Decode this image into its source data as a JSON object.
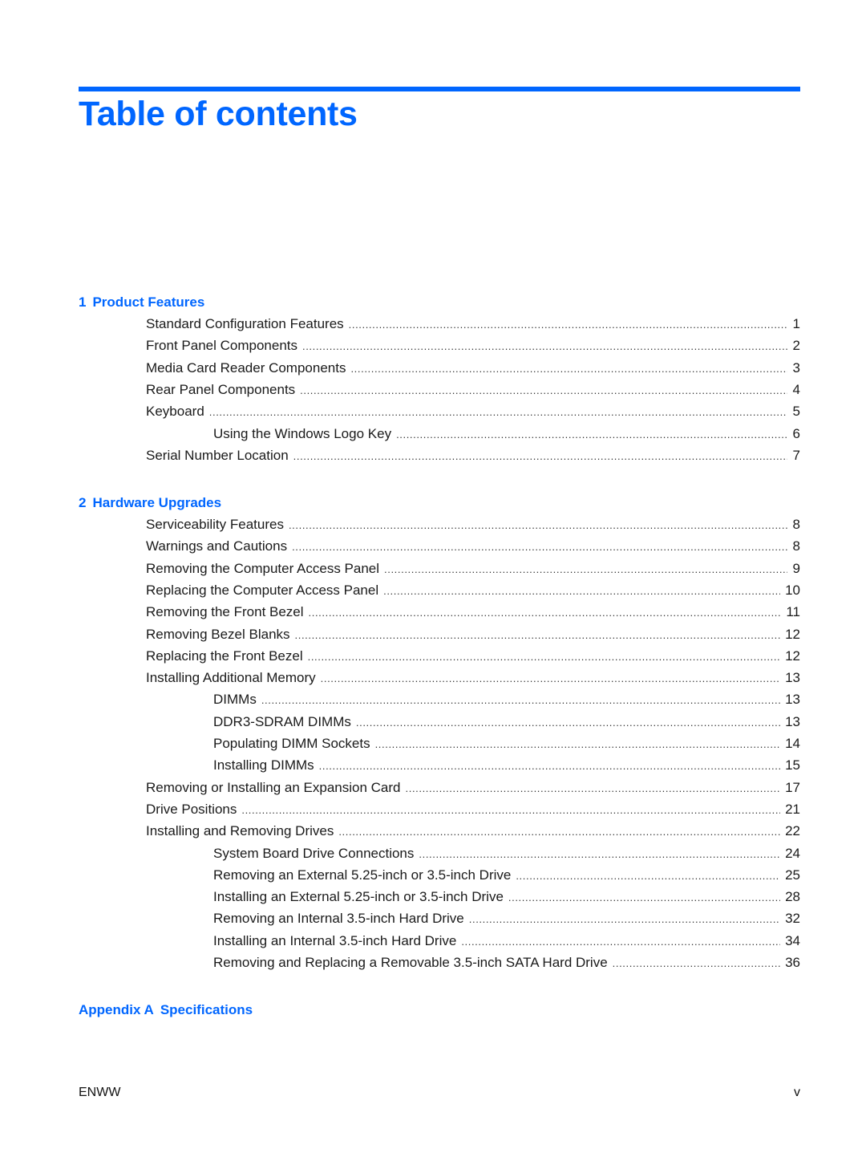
{
  "page": {
    "title": "Table of contents",
    "accent_color": "#0066ff",
    "footer_left": "ENWW",
    "footer_right": "v"
  },
  "chapters": [
    {
      "number": "1",
      "title": "Product Features",
      "entries": [
        {
          "level": 1,
          "text": "Standard Configuration Features",
          "page": "1"
        },
        {
          "level": 1,
          "text": "Front Panel Components",
          "page": "2"
        },
        {
          "level": 1,
          "text": "Media Card Reader Components",
          "page": "3"
        },
        {
          "level": 1,
          "text": "Rear Panel Components",
          "page": "4"
        },
        {
          "level": 1,
          "text": "Keyboard",
          "page": "5"
        },
        {
          "level": 2,
          "text": "Using the Windows Logo Key",
          "page": "6"
        },
        {
          "level": 1,
          "text": "Serial Number Location",
          "page": "7"
        }
      ]
    },
    {
      "number": "2",
      "title": "Hardware Upgrades",
      "entries": [
        {
          "level": 1,
          "text": "Serviceability Features",
          "page": "8"
        },
        {
          "level": 1,
          "text": "Warnings and Cautions",
          "page": "8"
        },
        {
          "level": 1,
          "text": "Removing the Computer Access Panel",
          "page": "9"
        },
        {
          "level": 1,
          "text": "Replacing the Computer Access Panel",
          "page": "10"
        },
        {
          "level": 1,
          "text": "Removing the Front Bezel",
          "page": "11"
        },
        {
          "level": 1,
          "text": "Removing Bezel Blanks",
          "page": "12"
        },
        {
          "level": 1,
          "text": "Replacing the Front Bezel",
          "page": "12"
        },
        {
          "level": 1,
          "text": "Installing Additional Memory",
          "page": "13"
        },
        {
          "level": 2,
          "text": "DIMMs",
          "page": "13"
        },
        {
          "level": 2,
          "text": "DDR3-SDRAM DIMMs",
          "page": "13"
        },
        {
          "level": 2,
          "text": "Populating DIMM Sockets",
          "page": "14"
        },
        {
          "level": 2,
          "text": "Installing DIMMs",
          "page": "15"
        },
        {
          "level": 1,
          "text": "Removing or Installing an Expansion Card",
          "page": "17"
        },
        {
          "level": 1,
          "text": "Drive Positions",
          "page": "21"
        },
        {
          "level": 1,
          "text": "Installing and Removing Drives",
          "page": "22"
        },
        {
          "level": 2,
          "text": "System Board Drive Connections",
          "page": "24"
        },
        {
          "level": 2,
          "text": "Removing an External 5.25-inch or 3.5-inch Drive",
          "page": "25"
        },
        {
          "level": 2,
          "text": "Installing an External 5.25-inch or 3.5-inch Drive",
          "page": "28"
        },
        {
          "level": 2,
          "text": "Removing an Internal 3.5-inch Hard Drive",
          "page": "32"
        },
        {
          "level": 2,
          "text": "Installing an Internal 3.5-inch Hard Drive",
          "page": "34"
        },
        {
          "level": 2,
          "text": "Removing and Replacing a Removable 3.5-inch SATA Hard Drive",
          "page": "36"
        }
      ]
    },
    {
      "number": "Appendix A",
      "title": "Specifications",
      "entries": []
    }
  ]
}
